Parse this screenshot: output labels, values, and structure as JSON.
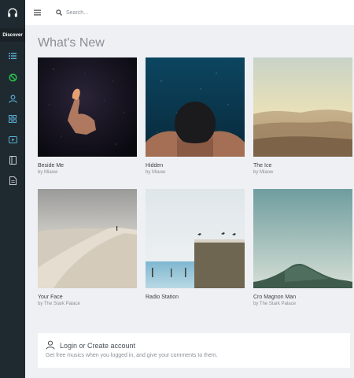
{
  "sidebar": {
    "discover_label": "Discover",
    "icons": [
      "headphones-icon",
      "list-icon",
      "no-music-icon",
      "profile-icon",
      "grid-icon",
      "video-icon",
      "book-icon",
      "document-icon"
    ],
    "accent_color": "#27c24c"
  },
  "search": {
    "placeholder": "Search..."
  },
  "page": {
    "title": "What's New"
  },
  "cards": [
    {
      "title": "Beside Me",
      "artist": "by Miaow"
    },
    {
      "title": "Hidden",
      "artist": "by Miaow"
    },
    {
      "title": "The Ice",
      "artist": "by Miaow"
    },
    {
      "title": "Your Face",
      "artist": "by The Stark Palace"
    },
    {
      "title": "Radio Station",
      "artist": ""
    },
    {
      "title": "Cro Magnon Man",
      "artist": "by The Stark Palace"
    }
  ],
  "login": {
    "title": "Login or Create account",
    "subtitle": "Get free musics when you logged in, and give your comments to them."
  }
}
